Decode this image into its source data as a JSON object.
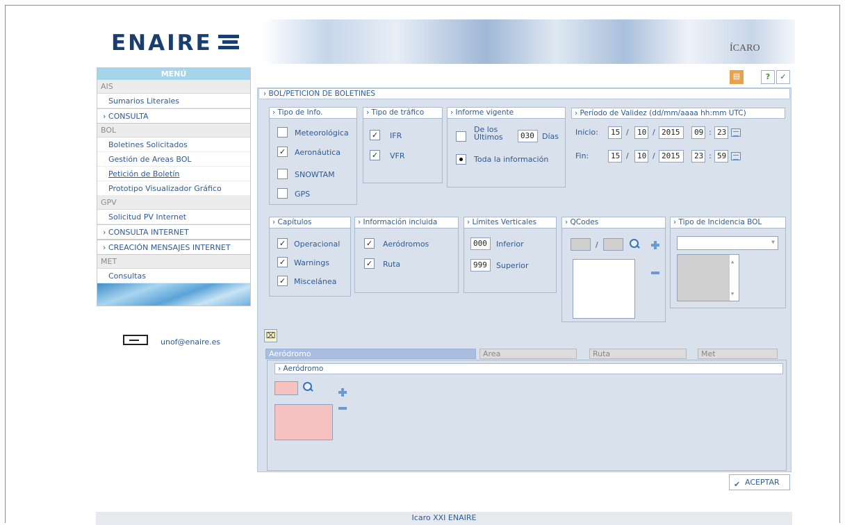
{
  "header": {
    "logo_main": "ENAIRE",
    "logo_badge": "ÍCARO"
  },
  "menu": {
    "title": "MENÚ",
    "ais": "AIS",
    "ais_items": [
      "Sumarios Literales"
    ],
    "consulta": "CONSULTA",
    "bol": "BOL",
    "bol_items": [
      "Boletines Solicitados",
      "Gestión de Areas BOL",
      "Petición de Boletín",
      "Prototipo Visualizador Gráfico"
    ],
    "gpv": "GPV",
    "gpv_items": [
      "Solicitud PV Internet"
    ],
    "consulta_internet": "CONSULTA INTERNET",
    "creacion": "CREACIÓN MENSAJES INTERNET",
    "met": "MET",
    "met_items": [
      "Consultas"
    ]
  },
  "contact": {
    "email": "unof@enaire.es"
  },
  "toolbar": {
    "help": "?",
    "check": "✓"
  },
  "main": {
    "crumb": "BOL/PETICION DE BOLETINES",
    "tipo_info": {
      "title": "Tipo de Info.",
      "items": [
        "Meteorológica",
        "Aeronáutica",
        "SNOWTAM",
        "GPS"
      ],
      "checked": [
        false,
        true,
        false,
        false
      ]
    },
    "tipo_trafico": {
      "title": "Tipo de tráfico",
      "items": [
        "IFR",
        "VFR"
      ],
      "checked": [
        true,
        true
      ]
    },
    "informe": {
      "title": "Informe vigente",
      "de_los": "De los",
      "ultimos": "Últimos",
      "dias_value": "030",
      "dias": "Días",
      "toda": "Toda la información"
    },
    "periodo": {
      "title": "Período de Validez (dd/mm/aaaa hh:mm UTC)",
      "inicio": "Inicio:",
      "fin": "Fin:",
      "ini_d": "15",
      "ini_m": "10",
      "ini_y": "2015",
      "ini_h": "09",
      "ini_min": "23",
      "fin_d": "15",
      "fin_m": "10",
      "fin_y": "2015",
      "fin_h": "23",
      "fin_min": "59",
      "slash": "/",
      "colon": ":"
    },
    "capitulos": {
      "title": "Capítulos",
      "items": [
        "Operacional",
        "Warnings",
        "Miscelánea"
      ],
      "checked": [
        true,
        true,
        true
      ]
    },
    "info_incl": {
      "title": "Información incluida",
      "items": [
        "Aeródromos",
        "Ruta"
      ],
      "checked": [
        true,
        true
      ]
    },
    "limites": {
      "title": "Límites Verticales",
      "inf_val": "000",
      "inf": "Inferior",
      "sup_val": "999",
      "sup": "Superior"
    },
    "qcodes": {
      "title": "QCodes",
      "slash": "/"
    },
    "incidencia": {
      "title": "Tipo de Incidencia BOL"
    },
    "tabs": [
      "Aeródromo",
      "Area",
      "Ruta",
      "Met"
    ],
    "aerodromo": {
      "title": "Aeródromo"
    },
    "accept": "ACEPTAR"
  },
  "footer": "Icaro XXI ENAIRE",
  "colors": {
    "accent": "#2e5a93",
    "panel": "#d8e1ec",
    "menu_title": "#a6d4ea",
    "pink": "#f5c1c1"
  }
}
